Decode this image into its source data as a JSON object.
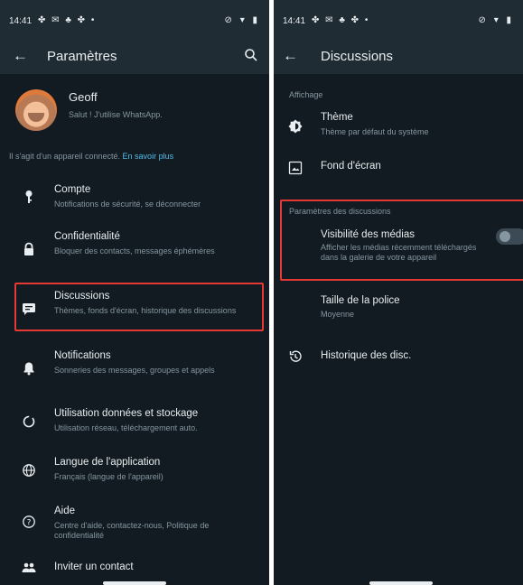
{
  "left": {
    "status_time": "14:41",
    "title": "Paramètres",
    "profile": {
      "name": "Geoff",
      "status": "Salut ! J'utilise WhatsApp."
    },
    "connected": {
      "text": "Il s'agit d'un appareil connecté.",
      "link": "En savoir plus"
    },
    "items": [
      {
        "icon": "key-icon",
        "title": "Compte",
        "subtitle": "Notifications de sécurité, se déconnecter"
      },
      {
        "icon": "lock-icon",
        "title": "Confidentialité",
        "subtitle": "Bloquer des contacts, messages éphémères"
      },
      {
        "icon": "chat-icon",
        "title": "Discussions",
        "subtitle": "Thèmes, fonds d'écran, historique des discussions"
      },
      {
        "icon": "bell-icon",
        "title": "Notifications",
        "subtitle": "Sonneries des messages, groupes et appels"
      },
      {
        "icon": "data-usage-icon",
        "title": "Utilisation données et stockage",
        "subtitle": "Utilisation réseau, téléchargement auto."
      },
      {
        "icon": "globe-icon",
        "title": "Langue de l'application",
        "subtitle": "Français (langue de l'appareil)"
      },
      {
        "icon": "help-icon",
        "title": "Aide",
        "subtitle": "Centre d'aide, contactez-nous, Politique de confidentialité"
      },
      {
        "icon": "people-icon",
        "title": "Inviter un contact",
        "subtitle": ""
      }
    ]
  },
  "right": {
    "status_time": "14:41",
    "title": "Discussions",
    "section_display": "Affichage",
    "theme": {
      "title": "Thème",
      "subtitle": "Thème par défaut du système"
    },
    "wallpaper": {
      "title": "Fond d'écran"
    },
    "section_chats": "Paramètres des discussions",
    "media_visibility": {
      "title": "Visibilité des médias",
      "subtitle": "Afficher les médias récemment téléchargés dans la galerie de votre appareil",
      "enabled": false
    },
    "font_size": {
      "title": "Taille de la police",
      "subtitle": "Moyenne"
    },
    "history": {
      "title": "Historique des disc."
    }
  },
  "colors": {
    "background": "#121b22",
    "appbar": "#1f2c34",
    "text_primary": "#e9edef",
    "text_secondary": "#8696a0",
    "link": "#53bdeb",
    "highlight": "#e53935"
  }
}
